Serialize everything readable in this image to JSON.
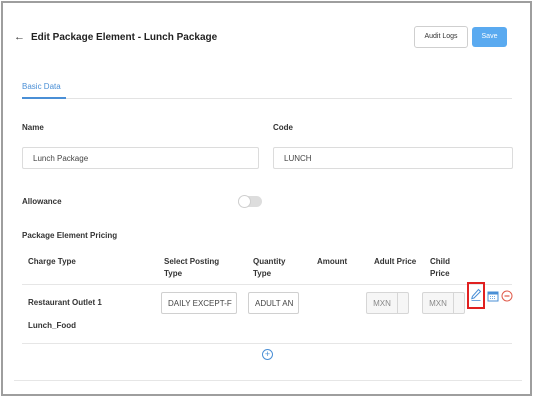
{
  "header": {
    "back_icon": "arrow-left-icon",
    "title": "Edit Package Element - Lunch Package",
    "audit_logs_label": "Audit Logs",
    "save_label": "Save"
  },
  "tabs": [
    {
      "label": "Basic Data",
      "active": true
    }
  ],
  "form": {
    "name_label": "Name",
    "name_value": "Lunch Package",
    "code_label": "Code",
    "code_value": "LUNCH",
    "allowance_label": "Allowance",
    "allowance_on": false
  },
  "pricing": {
    "section_label": "Package Element Pricing",
    "columns": {
      "charge_type": "Charge Type",
      "posting_type_1": "Select Posting",
      "posting_type_2": "Type",
      "quantity_type_1": "Quantity",
      "quantity_type_2": "Type",
      "amount": "Amount",
      "adult_price": "Adult Price",
      "child_price_1": "Child",
      "child_price_2": "Price"
    },
    "rows": [
      {
        "charge_type_line1": "Restaurant Outlet 1",
        "charge_type_line2": "Lunch_Food",
        "posting_type": "DAILY EXCEPT-F",
        "quantity_type": "ADULT AN",
        "adult_currency": "MXN",
        "child_currency": "MXN"
      }
    ],
    "row_actions": [
      "edit-pencil-icon",
      "calendar-icon",
      "remove-circle-icon"
    ],
    "add_icon": "add-circle-icon"
  },
  "colors": {
    "accent": "#4a8fd6",
    "save_button": "#5aaaf0",
    "remove": "#e05a4a",
    "highlight": "#e02020"
  }
}
